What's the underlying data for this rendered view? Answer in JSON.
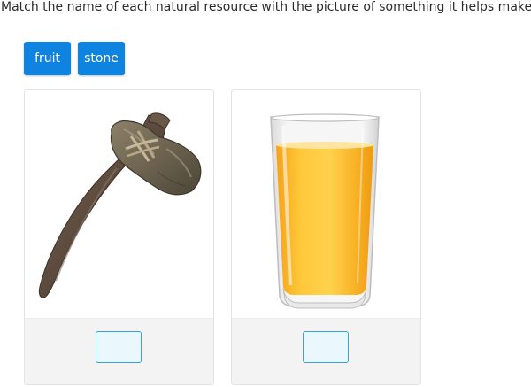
{
  "instruction": "Match the name of each natural resource with the picture of something it helps make.",
  "tiles": [
    {
      "label": "fruit"
    },
    {
      "label": "stone"
    }
  ],
  "cards": [
    {
      "picture": "stone-axe-icon",
      "answer": ""
    },
    {
      "picture": "orange-juice-glass-icon",
      "answer": ""
    }
  ],
  "colors": {
    "tile_bg": "#0f83e0",
    "dropbox_bg": "#eaf7fd",
    "dropbox_border": "#3aa0d8",
    "tray_bg": "#f3f3f3"
  }
}
